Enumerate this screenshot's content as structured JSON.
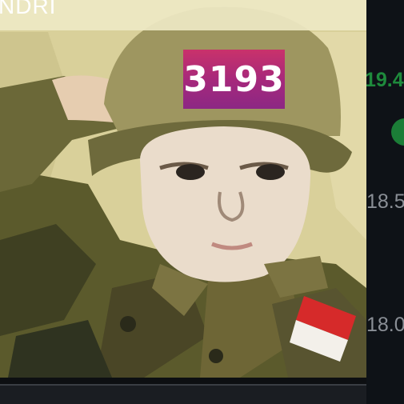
{
  "photo": {
    "title_text": "NDRI",
    "badge_number": "3193",
    "badge_color": "#a4287c",
    "flag_colors": [
      "#d62a2a",
      "#f3f0ea"
    ]
  },
  "side_panel": {
    "price_value": "19.4",
    "status_dot_color": "#1b7d37",
    "axis_ticks": [
      "18.5",
      "18.0"
    ]
  }
}
